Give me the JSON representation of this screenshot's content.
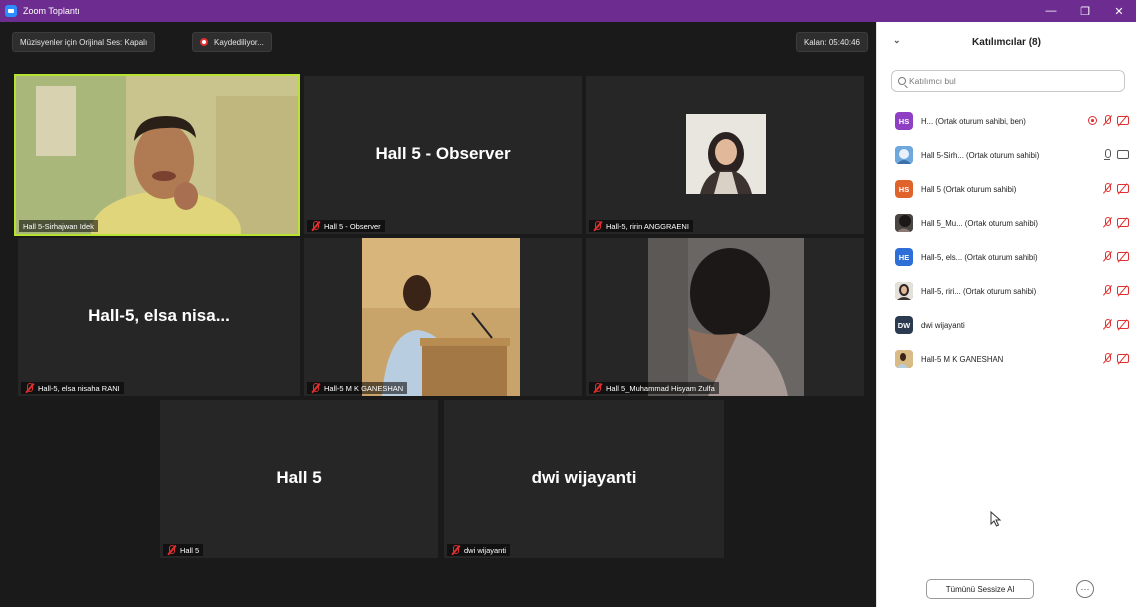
{
  "window": {
    "title": "Zoom Toplantı",
    "minimize": "—",
    "maximize": "❐",
    "close": "✕"
  },
  "toolbar": {
    "audio_button": "Müzisyenler için Orijinal Ses: Kapalı",
    "recording_button": "Kaydediliyor...",
    "remaining": "Kalan: 05:40:46"
  },
  "tiles": [
    {
      "label": "Hall 5-Sirhajwan Idek",
      "big": ""
    },
    {
      "label": "Hall 5 - Observer",
      "big": "Hall 5 - Observer"
    },
    {
      "label": "Hall-5, ririn ANGGRAENI",
      "big": ""
    },
    {
      "label": "Hall-5, elsa nisaha RANI",
      "big": "Hall-5, elsa nisa..."
    },
    {
      "label": "Hall-5 M K GANESHAN",
      "big": ""
    },
    {
      "label": "Hall 5_Muhammad Hisyam Zulfa",
      "big": ""
    },
    {
      "label": "Hall 5",
      "big": "Hall 5"
    },
    {
      "label": "dwi wijayanti",
      "big": "dwi wijayanti"
    }
  ],
  "panel": {
    "title": "Katılımcılar (8)",
    "search_placeholder": "Katılımcı bul",
    "participants": [
      {
        "initials": "HS",
        "color": "#8e3fc4",
        "name": "H... (Ortak oturum sahibi, ben)"
      },
      {
        "initials": "",
        "color": "#4a8ed6",
        "name": "Hall 5-Sirh... (Ortak oturum sahibi)"
      },
      {
        "initials": "HS",
        "color": "#e0632c",
        "name": "Hall 5 (Ortak oturum sahibi)"
      },
      {
        "initials": "",
        "color": "#3a3a3a",
        "name": "Hall 5_Mu... (Ortak oturum sahibi)"
      },
      {
        "initials": "HE",
        "color": "#2d6fd6",
        "name": "Hall-5, els... (Ortak oturum sahibi)"
      },
      {
        "initials": "",
        "color": "#8a7a76",
        "name": "Hall-5, riri... (Ortak oturum sahibi)"
      },
      {
        "initials": "DW",
        "color": "#2b3a4e",
        "name": "dwi wijayanti"
      },
      {
        "initials": "",
        "color": "#9b7a52",
        "name": "Hall-5 M K GANESHAN"
      }
    ],
    "mute_all": "Tümünü Sessize Al",
    "more": "···"
  }
}
